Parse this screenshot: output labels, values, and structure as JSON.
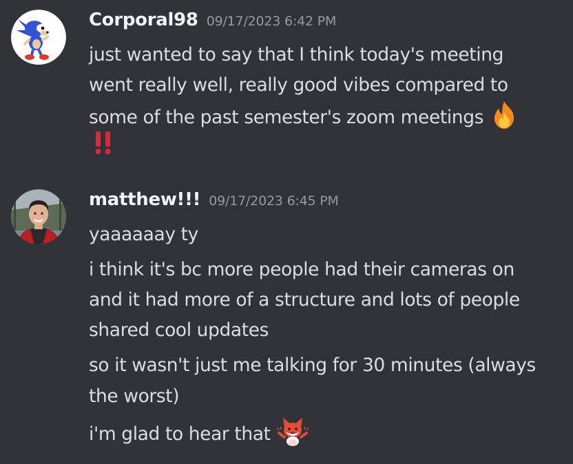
{
  "messages": [
    {
      "author": "Corporal98",
      "timestamp": "09/17/2023 6:42 PM",
      "lines": [
        "just wanted to say that I think today's meeting",
        "went really well, really good vibes compared to",
        "some of the past semester's zoom meetings"
      ],
      "emojis": [
        "fire-emoji",
        "double-exclamation-emoji"
      ]
    },
    {
      "author": "matthew!!!",
      "timestamp": "09/17/2023 6:45 PM",
      "lines": [
        "yaaaaaay ty",
        "i think it's bc more people had their cameras on",
        "and it had more of a structure and lots of people",
        "shared cool updates",
        "so it wasn't just me talking for 30 minutes (always",
        "the worst)",
        "i'm glad to hear that"
      ],
      "emojis": [
        "fox-cheer-emoji"
      ]
    }
  ],
  "colors": {
    "background": "#313338",
    "username": "#f2f3f5",
    "timestamp": "#949ba4",
    "text": "#dbdee1"
  }
}
